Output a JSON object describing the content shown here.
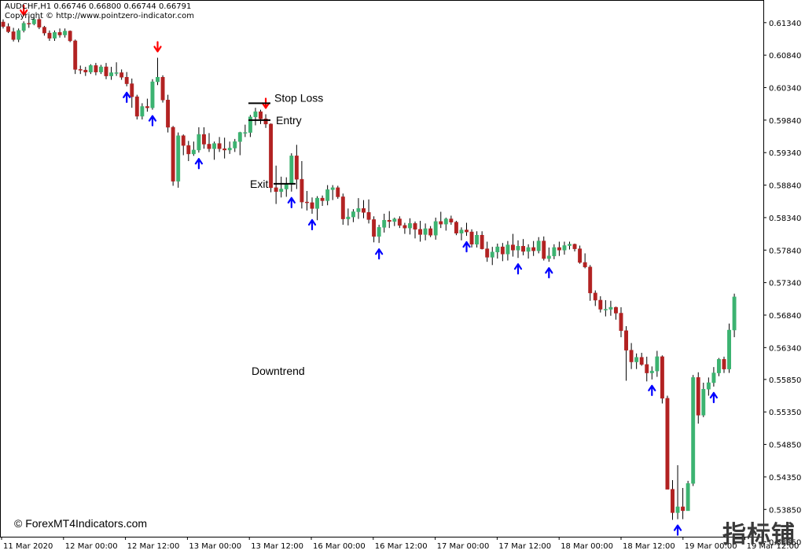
{
  "header": {
    "symbol_line": "AUDCHF,H1  0.66746 0.66800 0.66744 0.66791",
    "copyright": "Copyright © http://www.pointzero-indicator.com"
  },
  "footer": "© ForexMT4Indicators.com",
  "watermark": "指标铺",
  "colors": {
    "background": "#ffffff",
    "axis": "#000000",
    "bull": "#3cb371",
    "bear": "#b22222",
    "arrow_up": "#0000ff",
    "arrow_down": "#ff0000",
    "level_line": "#000000"
  },
  "chart_data": {
    "type": "candlestick",
    "symbol": "AUDCHF",
    "timeframe": "H1",
    "ylim": [
      0.5343,
      0.6164
    ],
    "y_ticks": [
      "0.61340",
      "0.60840",
      "0.60340",
      "0.59840",
      "0.59340",
      "0.58840",
      "0.58340",
      "0.57840",
      "0.57340",
      "0.56840",
      "0.56340",
      "0.55850",
      "0.55350",
      "0.54850",
      "0.54350",
      "0.53850",
      "0.53350"
    ],
    "x_ticks": [
      "11 Mar 2020",
      "12 Mar 00:00",
      "12 Mar 12:00",
      "13 Mar 00:00",
      "13 Mar 12:00",
      "16 Mar 00:00",
      "16 Mar 12:00",
      "17 Mar 00:00",
      "17 Mar 12:00",
      "18 Mar 00:00",
      "18 Mar 12:00",
      "19 Mar 00:00",
      "19 Mar 12:00"
    ],
    "candles_ohlc": [
      [
        0.6135,
        0.6139,
        0.6125,
        0.6128
      ],
      [
        0.6128,
        0.6133,
        0.6118,
        0.612
      ],
      [
        0.612,
        0.6126,
        0.6105,
        0.6108
      ],
      [
        0.6108,
        0.6125,
        0.6104,
        0.6122
      ],
      [
        0.6122,
        0.6136,
        0.6119,
        0.6133
      ],
      [
        0.6133,
        0.6144,
        0.6126,
        0.6132
      ],
      [
        0.6132,
        0.6142,
        0.613,
        0.6139
      ],
      [
        0.6139,
        0.6142,
        0.6124,
        0.6127
      ],
      [
        0.6127,
        0.6129,
        0.6114,
        0.6118
      ],
      [
        0.6118,
        0.6122,
        0.6106,
        0.611
      ],
      [
        0.611,
        0.6122,
        0.6106,
        0.6119
      ],
      [
        0.6119,
        0.6125,
        0.6111,
        0.6115
      ],
      [
        0.6115,
        0.6125,
        0.6111,
        0.6121
      ],
      [
        0.6121,
        0.6122,
        0.6104,
        0.6106
      ],
      [
        0.6106,
        0.6108,
        0.6055,
        0.6062
      ],
      [
        0.6062,
        0.6068,
        0.6055,
        0.6061
      ],
      [
        0.6061,
        0.6066,
        0.6052,
        0.6058
      ],
      [
        0.6058,
        0.607,
        0.6055,
        0.6068
      ],
      [
        0.6068,
        0.6072,
        0.6053,
        0.6058
      ],
      [
        0.6058,
        0.6069,
        0.6055,
        0.6066
      ],
      [
        0.6066,
        0.6072,
        0.6047,
        0.6052
      ],
      [
        0.6052,
        0.6066,
        0.6046,
        0.6057
      ],
      [
        0.6057,
        0.6073,
        0.6052,
        0.6057
      ],
      [
        0.6057,
        0.6062,
        0.6046,
        0.605
      ],
      [
        0.605,
        0.6058,
        0.6036,
        0.604
      ],
      [
        0.604,
        0.6048,
        0.6003,
        0.602
      ],
      [
        0.602,
        0.6023,
        0.5985,
        0.599
      ],
      [
        0.599,
        0.601,
        0.5985,
        0.6005
      ],
      [
        0.6005,
        0.6017,
        0.5997,
        0.6003
      ],
      [
        0.6003,
        0.6047,
        0.6,
        0.6043
      ],
      [
        0.6043,
        0.608,
        0.6038,
        0.605
      ],
      [
        0.605,
        0.6053,
        0.6011,
        0.6015
      ],
      [
        0.6015,
        0.6023,
        0.5965,
        0.5973
      ],
      [
        0.5973,
        0.5975,
        0.5883,
        0.589
      ],
      [
        0.589,
        0.5965,
        0.588,
        0.596
      ],
      [
        0.596,
        0.5962,
        0.593,
        0.5945
      ],
      [
        0.5945,
        0.5952,
        0.5921,
        0.5932
      ],
      [
        0.5932,
        0.5951,
        0.5929,
        0.5938
      ],
      [
        0.5938,
        0.5973,
        0.5934,
        0.5962
      ],
      [
        0.5962,
        0.5973,
        0.594,
        0.5947
      ],
      [
        0.5947,
        0.5964,
        0.5935,
        0.594
      ],
      [
        0.594,
        0.5951,
        0.5923,
        0.5948
      ],
      [
        0.5948,
        0.5958,
        0.5935,
        0.594
      ],
      [
        0.594,
        0.5957,
        0.5925,
        0.5938
      ],
      [
        0.5938,
        0.5951,
        0.5932,
        0.5941
      ],
      [
        0.5941,
        0.5955,
        0.5935,
        0.5951
      ],
      [
        0.5951,
        0.5966,
        0.593,
        0.5965
      ],
      [
        0.5965,
        0.5977,
        0.5958,
        0.5965
      ],
      [
        0.5965,
        0.5992,
        0.5958,
        0.5989
      ],
      [
        0.5989,
        0.6003,
        0.5976,
        0.5997
      ],
      [
        0.5997,
        0.6,
        0.5978,
        0.5986
      ],
      [
        0.5986,
        0.5993,
        0.5972,
        0.5978
      ],
      [
        0.5978,
        0.5979,
        0.5873,
        0.588
      ],
      [
        0.588,
        0.5914,
        0.5855,
        0.5874
      ],
      [
        0.5874,
        0.5897,
        0.5865,
        0.5878
      ],
      [
        0.5878,
        0.5896,
        0.5866,
        0.5885
      ],
      [
        0.5885,
        0.5933,
        0.5874,
        0.5929
      ],
      [
        0.5929,
        0.5946,
        0.5878,
        0.5893
      ],
      [
        0.5893,
        0.5921,
        0.5848,
        0.5858
      ],
      [
        0.5858,
        0.5875,
        0.5845,
        0.5857
      ],
      [
        0.5857,
        0.5865,
        0.584,
        0.5848
      ],
      [
        0.5848,
        0.5867,
        0.583,
        0.5864
      ],
      [
        0.5864,
        0.5868,
        0.5852,
        0.586
      ],
      [
        0.586,
        0.5884,
        0.5853,
        0.5877
      ],
      [
        0.5877,
        0.5884,
        0.5861,
        0.588
      ],
      [
        0.588,
        0.5883,
        0.5863,
        0.5866
      ],
      [
        0.5866,
        0.5871,
        0.5823,
        0.5832
      ],
      [
        0.5832,
        0.5848,
        0.5822,
        0.5835
      ],
      [
        0.5835,
        0.5847,
        0.5827,
        0.5843
      ],
      [
        0.5843,
        0.5864,
        0.5832,
        0.5848
      ],
      [
        0.5848,
        0.5861,
        0.5833,
        0.5842
      ],
      [
        0.5842,
        0.5862,
        0.5825,
        0.5831
      ],
      [
        0.5831,
        0.5836,
        0.5796,
        0.5805
      ],
      [
        0.5805,
        0.5823,
        0.5795,
        0.5819
      ],
      [
        0.5819,
        0.584,
        0.5811,
        0.583
      ],
      [
        0.583,
        0.5844,
        0.5818,
        0.5828
      ],
      [
        0.5828,
        0.5834,
        0.5821,
        0.5832
      ],
      [
        0.5832,
        0.5836,
        0.5818,
        0.5822
      ],
      [
        0.5822,
        0.5826,
        0.5809,
        0.5818
      ],
      [
        0.5818,
        0.5833,
        0.5808,
        0.5825
      ],
      [
        0.5825,
        0.5828,
        0.5802,
        0.5816
      ],
      [
        0.5816,
        0.5829,
        0.5797,
        0.5808
      ],
      [
        0.5808,
        0.5825,
        0.5799,
        0.5817
      ],
      [
        0.5817,
        0.5821,
        0.5804,
        0.5807
      ],
      [
        0.5807,
        0.5834,
        0.58,
        0.5828
      ],
      [
        0.5828,
        0.5843,
        0.5818,
        0.5824
      ],
      [
        0.5824,
        0.5834,
        0.5814,
        0.5832
      ],
      [
        0.5832,
        0.5837,
        0.5823,
        0.5827
      ],
      [
        0.5827,
        0.5829,
        0.5807,
        0.581
      ],
      [
        0.581,
        0.5819,
        0.5799,
        0.5815
      ],
      [
        0.5815,
        0.5826,
        0.5806,
        0.5812
      ],
      [
        0.5812,
        0.5816,
        0.5788,
        0.5793
      ],
      [
        0.5793,
        0.5813,
        0.5788,
        0.5807
      ],
      [
        0.5807,
        0.5813,
        0.5785,
        0.5786
      ],
      [
        0.5786,
        0.5797,
        0.5766,
        0.5773
      ],
      [
        0.5773,
        0.5789,
        0.5761,
        0.5781
      ],
      [
        0.5781,
        0.5794,
        0.5771,
        0.5789
      ],
      [
        0.5789,
        0.5795,
        0.5767,
        0.5778
      ],
      [
        0.5778,
        0.5798,
        0.5768,
        0.5792
      ],
      [
        0.5792,
        0.5809,
        0.5774,
        0.5784
      ],
      [
        0.5784,
        0.5799,
        0.5772,
        0.579
      ],
      [
        0.579,
        0.5801,
        0.5776,
        0.5782
      ],
      [
        0.5782,
        0.5793,
        0.5771,
        0.5788
      ],
      [
        0.5788,
        0.5798,
        0.5775,
        0.5783
      ],
      [
        0.5783,
        0.5804,
        0.5779,
        0.5798
      ],
      [
        0.5798,
        0.5805,
        0.5768,
        0.5771
      ],
      [
        0.5771,
        0.5788,
        0.5766,
        0.5775
      ],
      [
        0.5775,
        0.5793,
        0.577,
        0.5788
      ],
      [
        0.5788,
        0.5797,
        0.5775,
        0.5784
      ],
      [
        0.5784,
        0.5797,
        0.5777,
        0.5791
      ],
      [
        0.5791,
        0.5797,
        0.5785,
        0.5793
      ],
      [
        0.5793,
        0.5794,
        0.5782,
        0.5786
      ],
      [
        0.5786,
        0.5791,
        0.5763,
        0.5765
      ],
      [
        0.5765,
        0.5779,
        0.5756,
        0.5758
      ],
      [
        0.5758,
        0.5761,
        0.5706,
        0.5718
      ],
      [
        0.5718,
        0.5722,
        0.5698,
        0.5707
      ],
      [
        0.5707,
        0.5713,
        0.5688,
        0.5693
      ],
      [
        0.5693,
        0.5707,
        0.5682,
        0.5693
      ],
      [
        0.5693,
        0.5706,
        0.5683,
        0.5696
      ],
      [
        0.5696,
        0.5697,
        0.5677,
        0.5687
      ],
      [
        0.5687,
        0.5696,
        0.565,
        0.566
      ],
      [
        0.566,
        0.5667,
        0.5583,
        0.563
      ],
      [
        0.563,
        0.5641,
        0.5601,
        0.5612
      ],
      [
        0.5612,
        0.5625,
        0.5601,
        0.5619
      ],
      [
        0.5619,
        0.5626,
        0.5606,
        0.5608
      ],
      [
        0.5608,
        0.562,
        0.5582,
        0.5595
      ],
      [
        0.5595,
        0.5605,
        0.5585,
        0.5598
      ],
      [
        0.5598,
        0.5629,
        0.5589,
        0.562
      ],
      [
        0.562,
        0.5622,
        0.5548,
        0.5556
      ],
      [
        0.5556,
        0.556,
        0.5426,
        0.5416
      ],
      [
        0.5416,
        0.543,
        0.5369,
        0.538
      ],
      [
        0.538,
        0.5453,
        0.537,
        0.5389
      ],
      [
        0.5389,
        0.5418,
        0.537,
        0.5383
      ],
      [
        0.5383,
        0.5429,
        0.5385,
        0.5425
      ],
      [
        0.5425,
        0.5592,
        0.5421,
        0.5588
      ],
      [
        0.5588,
        0.5596,
        0.5517,
        0.553
      ],
      [
        0.553,
        0.558,
        0.5527,
        0.557
      ],
      [
        0.557,
        0.5588,
        0.556,
        0.558
      ],
      [
        0.558,
        0.5604,
        0.5574,
        0.5595
      ],
      [
        0.5595,
        0.5618,
        0.559,
        0.5616
      ],
      [
        0.5616,
        0.562,
        0.5595,
        0.5601
      ],
      [
        0.5601,
        0.5671,
        0.5595,
        0.5661
      ],
      [
        0.5661,
        0.5717,
        0.565,
        0.5712
      ]
    ],
    "buy_arrow_candles": [
      24,
      29,
      38,
      56,
      60,
      73,
      90,
      100,
      106,
      126,
      131,
      138
    ],
    "sell_arrow_candles": [
      4,
      30,
      51
    ],
    "annotations": [
      {
        "text": "Stop Loss",
        "price": 0.601
      },
      {
        "text": "Entry",
        "price": 0.5984
      },
      {
        "text": "Exit",
        "price": 0.5886
      },
      {
        "text": "Downtrend",
        "price": 0.5598
      }
    ]
  }
}
